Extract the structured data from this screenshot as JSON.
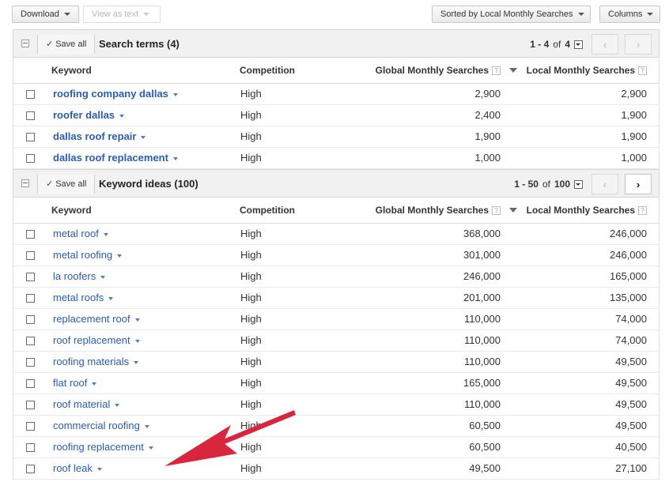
{
  "toolbar": {
    "download_label": "Download",
    "view_as_text_label": "View as text",
    "sorted_by_label": "Sorted by Local Monthly Searches",
    "columns_label": "Columns"
  },
  "columns": {
    "keyword": "Keyword",
    "competition": "Competition",
    "global": "Global Monthly Searches",
    "local": "Local Monthly Searches",
    "help": "?"
  },
  "search_terms": {
    "save_all": "Save all",
    "title": "Search terms (4)",
    "range": "1 - 4",
    "of": "of",
    "total": "4",
    "rows": [
      {
        "keyword": "roofing company dallas",
        "competition": "High",
        "global": "2,900",
        "local": "2,900"
      },
      {
        "keyword": "roofer dallas",
        "competition": "High",
        "global": "2,400",
        "local": "1,900"
      },
      {
        "keyword": "dallas roof repair",
        "competition": "High",
        "global": "1,900",
        "local": "1,900"
      },
      {
        "keyword": "dallas roof replacement",
        "competition": "High",
        "global": "1,000",
        "local": "1,000"
      }
    ]
  },
  "keyword_ideas": {
    "save_all": "Save all",
    "title": "Keyword ideas (100)",
    "range": "1 - 50",
    "of": "of",
    "total": "100",
    "rows": [
      {
        "keyword": "metal roof",
        "competition": "High",
        "global": "368,000",
        "local": "246,000"
      },
      {
        "keyword": "metal roofing",
        "competition": "High",
        "global": "301,000",
        "local": "246,000"
      },
      {
        "keyword": "la roofers",
        "competition": "High",
        "global": "246,000",
        "local": "165,000"
      },
      {
        "keyword": "metal roofs",
        "competition": "High",
        "global": "201,000",
        "local": "135,000"
      },
      {
        "keyword": "replacement roof",
        "competition": "High",
        "global": "110,000",
        "local": "74,000"
      },
      {
        "keyword": "roof replacement",
        "competition": "High",
        "global": "110,000",
        "local": "74,000"
      },
      {
        "keyword": "roofing materials",
        "competition": "High",
        "global": "110,000",
        "local": "49,500"
      },
      {
        "keyword": "flat roof",
        "competition": "High",
        "global": "165,000",
        "local": "49,500"
      },
      {
        "keyword": "roof material",
        "competition": "High",
        "global": "110,000",
        "local": "49,500"
      },
      {
        "keyword": "commercial roofing",
        "competition": "High",
        "global": "60,500",
        "local": "49,500"
      },
      {
        "keyword": "roofing replacement",
        "competition": "High",
        "global": "60,500",
        "local": "40,500"
      },
      {
        "keyword": "roof leak",
        "competition": "High",
        "global": "49,500",
        "local": "27,100"
      }
    ]
  },
  "annotation": {
    "arrow_color": "#d7263d"
  }
}
